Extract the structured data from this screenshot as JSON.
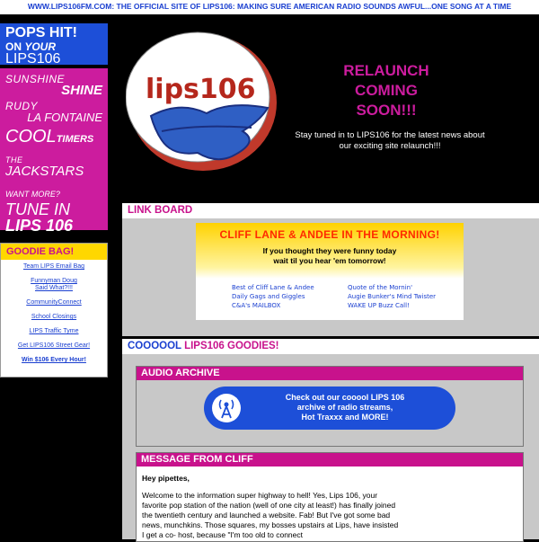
{
  "topbar": {
    "site": "WWW.LIPS106FM.COM:",
    "tagline": "THE OFFICIAL SITE OF LIPS106: MAKING SURE AMERICAN RADIO SOUNDS AWFUL...ONE SONG AT A TIME"
  },
  "sidebar": {
    "pops": {
      "line1": "POPS HIT!",
      "on": "ON",
      "your": "YOUR",
      "brand": "LIPS106"
    },
    "shows": [
      {
        "a": "SUNSHINE",
        "b": "SHINE"
      },
      {
        "a": "RUDY",
        "b": "LA FONTAINE"
      },
      {
        "a": "COOL",
        "b": "TIMERS"
      },
      {
        "a": "THE",
        "b": "JACKSTARS"
      }
    ],
    "want": "WANT MORE?",
    "tune": "TUNE IN",
    "lips": "LIPS 106",
    "goodie_title": "GOODIE BAG!",
    "goodie_links": [
      "Team LIPS Email Bag",
      "Funnyman Doug Said What?!!!",
      "CommunityConnect",
      "School Closings",
      "LIPS Traffic Tyme",
      "Get LIPS106 Street Gear!",
      "Win $106 Every Hour!"
    ]
  },
  "hero": {
    "logo_text": "lips106",
    "relaunch": [
      "RELAUNCH",
      "COMING",
      "SOON!!!"
    ],
    "stay": "Stay tuned in to LIPS106 for the latest news about our exciting site relaunch!!!"
  },
  "linkboard": {
    "title": "LINK BOARD",
    "banner_title": "CLIFF LANE & ANDEE IN THE MORNING!",
    "banner_line1": "If you thought they were funny today",
    "banner_line2": "wait til you hear 'em tomorrow!",
    "links": [
      "Best of Cliff Lane & Andee",
      "Quote of the Mornin'",
      "Daily Gags and Giggles",
      "Augie Bunker's Mind Twister",
      "C&A's MAILBOX",
      "WAKE UP Buzz Call!"
    ]
  },
  "goodies": {
    "title_a": "COOOOOL",
    "title_b": "LIPS106 GOODIES!",
    "audio_title": "AUDIO ARCHIVE",
    "audio_btn": [
      "Check out our cooool LIPS 106",
      "archive of radio streams,",
      "Hot Traxxx and MORE!"
    ],
    "message_title": "MESSAGE FROM CLIFF",
    "greeting": "Hey pipettes,",
    "body": "Welcome to the information super highway to hell! Yes, Lips 106, your favorite pop station of the nation (well of one city at least!) has finally joined the twentieth century and launched a website. Fab! But I've got some bad news, munchkins. Those squares, my bosses upstairs at Lips, have insisted I get a co- host, because \"I'm too old to connect"
  },
  "colors": {
    "pink": "#cc1c9e",
    "blue": "#1d4fd8",
    "yellow": "#ffd700"
  }
}
